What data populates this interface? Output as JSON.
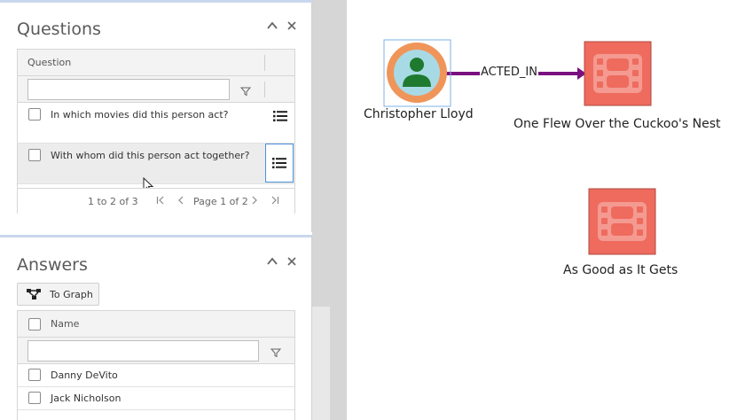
{
  "questions": {
    "title": "Questions",
    "column_header": "Question",
    "filter_value": "",
    "rows": [
      {
        "text": "In which movies did this person act?"
      },
      {
        "text": "With whom did this person act together?"
      }
    ],
    "pager": {
      "range": "1 to 2 of 3",
      "page": "Page 1 of 2"
    }
  },
  "answers": {
    "title": "Answers",
    "to_graph_label": "To Graph",
    "column_header": "Name",
    "filter_value": "",
    "rows": [
      {
        "text": "Danny DeVito"
      },
      {
        "text": "Jack Nicholson"
      }
    ]
  },
  "graph": {
    "person": {
      "label": "Christopher Lloyd"
    },
    "edge": {
      "label": "ACTED_IN"
    },
    "movies": [
      {
        "label": "One Flew Over the Cuckoo's Nest"
      },
      {
        "label": "As Good as It Gets"
      }
    ],
    "colors": {
      "person_ring": "#f0955a",
      "person_inner": "#a8dae5",
      "person_icon": "#1e7a2e",
      "movie_fill": "#ee6b5e",
      "movie_stroke": "#b04a40",
      "edge": "#7a0f7f",
      "selection": "#7fb2e5"
    }
  }
}
